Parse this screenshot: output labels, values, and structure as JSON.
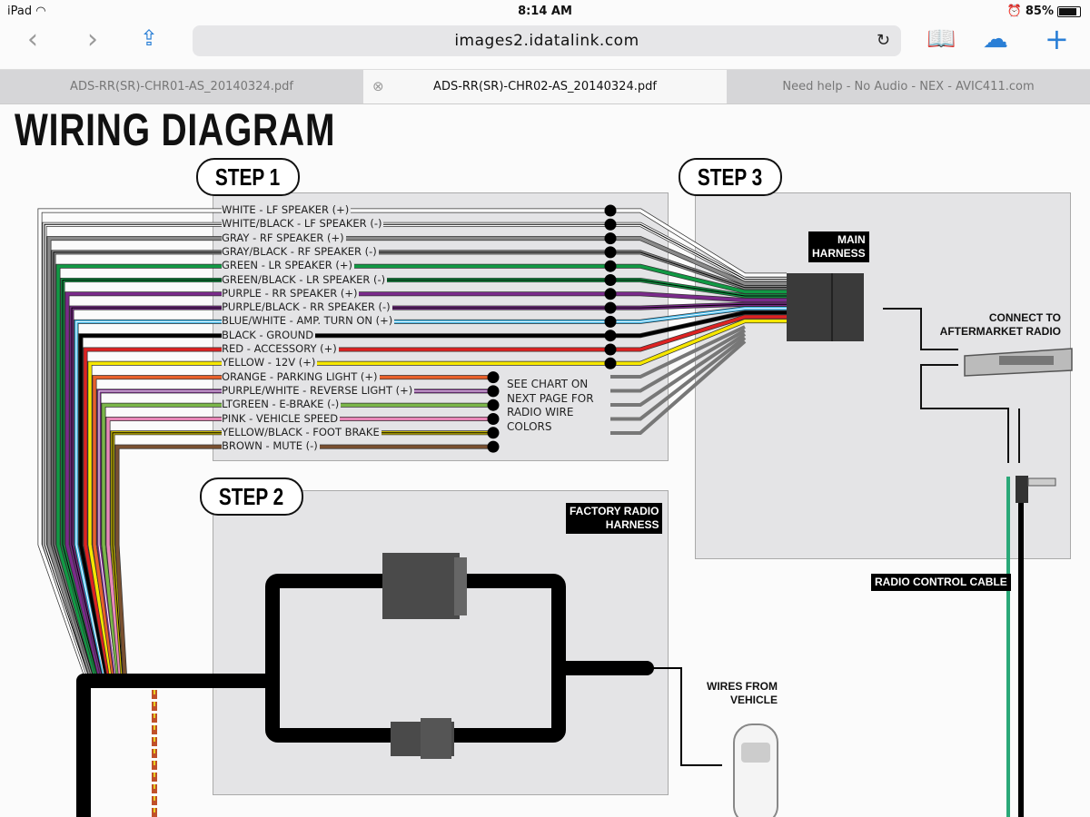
{
  "status_bar": {
    "device": "iPad",
    "time": "8:14 AM",
    "battery_percent": "85%",
    "battery_level": 0.85
  },
  "toolbar": {
    "url": "images2.idatalink.com",
    "icons": [
      "back-icon",
      "forward-icon",
      "share-icon",
      "reload-icon",
      "bookmarks-icon",
      "icloud-tabs-icon",
      "new-tab-icon"
    ]
  },
  "tabs": [
    {
      "label": "ADS-RR(SR)-CHR01-AS_20140324.pdf",
      "active": false
    },
    {
      "label": "ADS-RR(SR)-CHR02-AS_20140324.pdf",
      "active": true
    },
    {
      "label": "Need help - No Audio - NEX - AVIC411.com",
      "active": false
    }
  ],
  "diagram": {
    "title": "WIRING DIAGRAM",
    "steps": [
      "STEP 1",
      "STEP 2",
      "STEP 3"
    ],
    "wires": [
      {
        "label": "WHITE - LF SPEAKER (+)",
        "color": "#ffffff",
        "stripe": ""
      },
      {
        "label": "WHITE/BLACK - LF SPEAKER (-)",
        "color": "#ffffff",
        "stripe": "#000000"
      },
      {
        "label": "GRAY - RF SPEAKER (+)",
        "color": "#8a8a8a",
        "stripe": ""
      },
      {
        "label": "GRAY/BLACK - RF SPEAKER (-)",
        "color": "#8a8a8a",
        "stripe": "#000000"
      },
      {
        "label": "GREEN - LR SPEAKER (+)",
        "color": "#119944",
        "stripe": ""
      },
      {
        "label": "GREEN/BLACK - LR SPEAKER (-)",
        "color": "#119944",
        "stripe": "#000000"
      },
      {
        "label": "PURPLE - RR SPEAKER (+)",
        "color": "#7a2a8a",
        "stripe": ""
      },
      {
        "label": "PURPLE/BLACK - RR SPEAKER (-)",
        "color": "#7a2a8a",
        "stripe": "#000000"
      },
      {
        "label": "BLUE/WHITE - AMP. TURN ON (+)",
        "color": "#3ab4e8",
        "stripe": "#ffffff"
      },
      {
        "label": "BLACK - GROUND",
        "color": "#000000",
        "stripe": ""
      },
      {
        "label": "RED - ACCESSORY (+)",
        "color": "#dd2222",
        "stripe": ""
      },
      {
        "label": "YELLOW - 12V (+)",
        "color": "#f5e600",
        "stripe": ""
      },
      {
        "label": "ORANGE - PARKING LIGHT (+)",
        "color": "#e8602a",
        "stripe": ""
      },
      {
        "label": "PURPLE/WHITE - REVERSE LIGHT (+)",
        "color": "#7a2a8a",
        "stripe": "#ffffff"
      },
      {
        "label": "LTGREEN - E-BRAKE (-)",
        "color": "#7ab648",
        "stripe": ""
      },
      {
        "label": "PINK - VEHICLE SPEED",
        "color": "#e888b8",
        "stripe": ""
      },
      {
        "label": "YELLOW/BLACK - FOOT BRAKE",
        "color": "#c8b800",
        "stripe": "#000000"
      },
      {
        "label": "BROWN - MUTE (-)",
        "color": "#7a5030",
        "stripe": ""
      }
    ],
    "note": [
      "SEE CHART ON",
      "NEXT PAGE FOR",
      "RADIO WIRE",
      "COLORS"
    ],
    "labels": {
      "main_harness": [
        "MAIN",
        "HARNESS"
      ],
      "connect_to": [
        "CONNECT TO",
        "AFTERMARKET RADIO"
      ],
      "factory_radio_harness": [
        "FACTORY RADIO",
        "HARNESS"
      ],
      "wires_from_vehicle": [
        "WIRES FROM",
        "VEHICLE"
      ],
      "radio_control_cable": "RADIO CONTROL CABLE"
    }
  }
}
